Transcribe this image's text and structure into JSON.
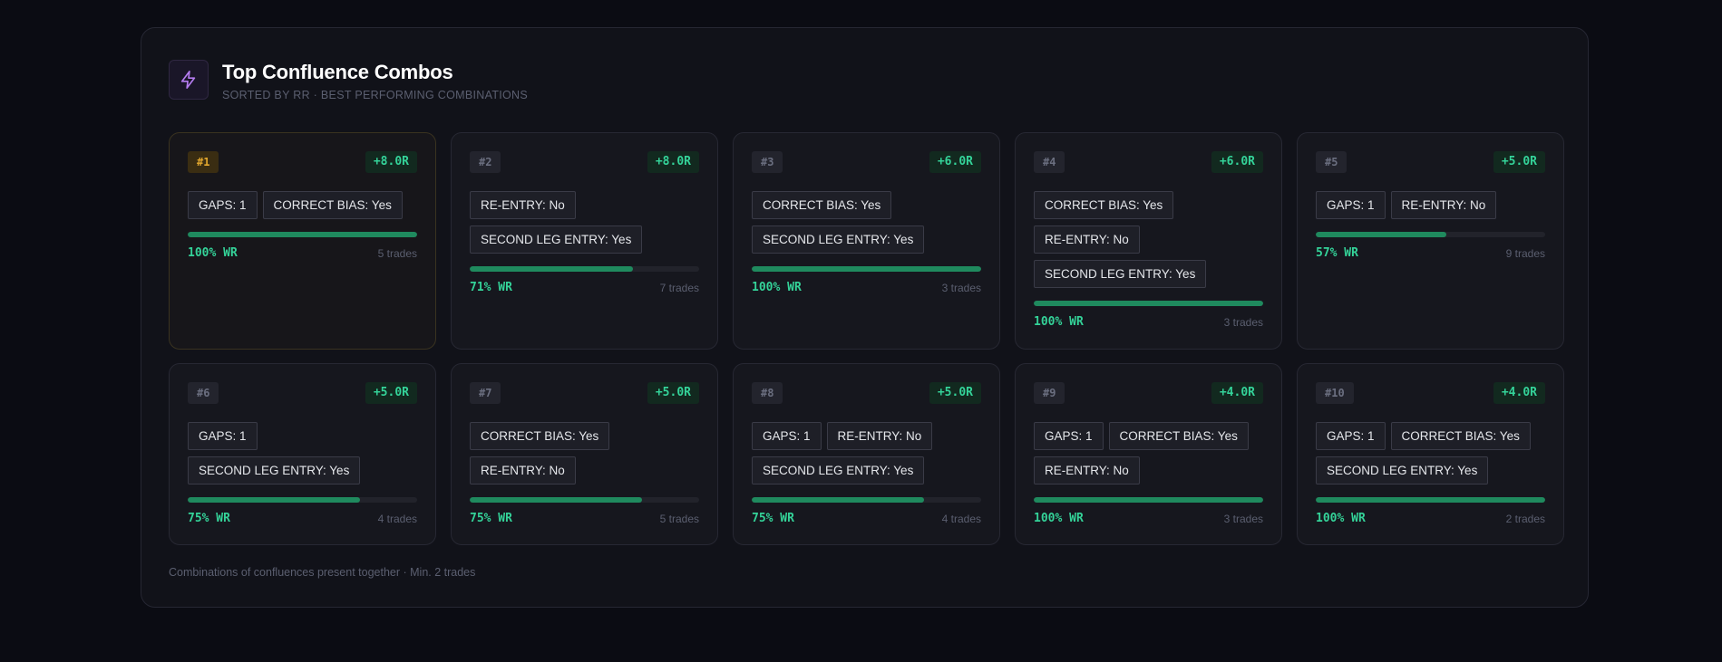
{
  "header": {
    "title": "Top Confluence Combos",
    "subtitle": "SORTED BY RR · BEST PERFORMING COMBINATIONS",
    "icon": "bolt-icon"
  },
  "colors": {
    "accent_green": "#34d399",
    "bar_green": "#1f8a5e",
    "gold": "#e2a72e",
    "icon_purple": "#b57cf0"
  },
  "combos": [
    {
      "rank": "#1",
      "rr": "+8.0R",
      "tags": [
        "GAPS: 1",
        "CORRECT BIAS: Yes"
      ],
      "win_rate": 1.0,
      "wr_label": "100% WR",
      "trades": "5 trades"
    },
    {
      "rank": "#2",
      "rr": "+8.0R",
      "tags": [
        "RE-ENTRY: No",
        "SECOND LEG ENTRY: Yes"
      ],
      "win_rate": 0.71,
      "wr_label": "71% WR",
      "trades": "7 trades"
    },
    {
      "rank": "#3",
      "rr": "+6.0R",
      "tags": [
        "CORRECT BIAS: Yes",
        "SECOND LEG ENTRY: Yes"
      ],
      "win_rate": 1.0,
      "wr_label": "100% WR",
      "trades": "3 trades"
    },
    {
      "rank": "#4",
      "rr": "+6.0R",
      "tags": [
        "CORRECT BIAS: Yes",
        "RE-ENTRY: No",
        "SECOND LEG ENTRY: Yes"
      ],
      "win_rate": 1.0,
      "wr_label": "100% WR",
      "trades": "3 trades"
    },
    {
      "rank": "#5",
      "rr": "+5.0R",
      "tags": [
        "GAPS: 1",
        "RE-ENTRY: No"
      ],
      "win_rate": 0.57,
      "wr_label": "57% WR",
      "trades": "9 trades"
    },
    {
      "rank": "#6",
      "rr": "+5.0R",
      "tags": [
        "GAPS: 1",
        "SECOND LEG ENTRY: Yes"
      ],
      "win_rate": 0.75,
      "wr_label": "75% WR",
      "trades": "4 trades"
    },
    {
      "rank": "#7",
      "rr": "+5.0R",
      "tags": [
        "CORRECT BIAS: Yes",
        "RE-ENTRY: No"
      ],
      "win_rate": 0.75,
      "wr_label": "75% WR",
      "trades": "5 trades"
    },
    {
      "rank": "#8",
      "rr": "+5.0R",
      "tags": [
        "GAPS: 1",
        "RE-ENTRY: No",
        "SECOND LEG ENTRY: Yes"
      ],
      "win_rate": 0.75,
      "wr_label": "75% WR",
      "trades": "4 trades"
    },
    {
      "rank": "#9",
      "rr": "+4.0R",
      "tags": [
        "GAPS: 1",
        "CORRECT BIAS: Yes",
        "RE-ENTRY: No"
      ],
      "win_rate": 1.0,
      "wr_label": "100% WR",
      "trades": "3 trades"
    },
    {
      "rank": "#10",
      "rr": "+4.0R",
      "tags": [
        "GAPS: 1",
        "CORRECT BIAS: Yes",
        "SECOND LEG ENTRY: Yes"
      ],
      "win_rate": 1.0,
      "wr_label": "100% WR",
      "trades": "2 trades"
    }
  ],
  "footnote": "Combinations of confluences present together · Min. 2 trades"
}
